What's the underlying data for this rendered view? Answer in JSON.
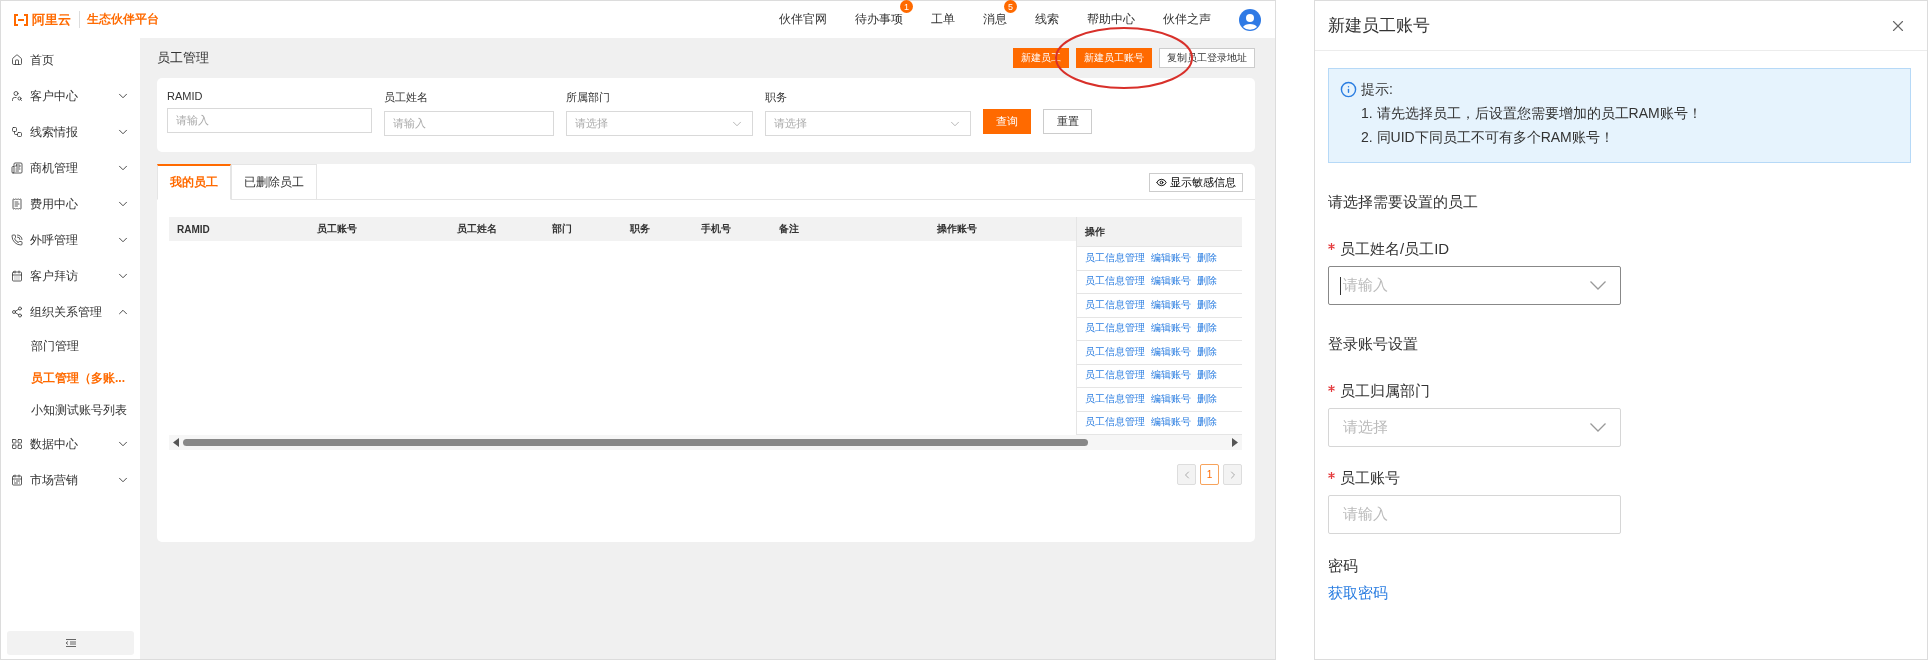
{
  "header": {
    "logo": "阿里云",
    "platform": "生态伙伴平台",
    "nav": [
      {
        "label": "伙伴官网"
      },
      {
        "label": "待办事项",
        "badge": "1"
      },
      {
        "label": "工单"
      },
      {
        "label": "消息",
        "badge": "5"
      },
      {
        "label": "线索"
      },
      {
        "label": "帮助中心"
      },
      {
        "label": "伙伴之声"
      }
    ]
  },
  "sidebar": {
    "items": [
      {
        "label": "首页"
      },
      {
        "label": "客户中心",
        "expanded": false
      },
      {
        "label": "线索情报",
        "expanded": false
      },
      {
        "label": "商机管理",
        "expanded": false
      },
      {
        "label": "费用中心",
        "expanded": false
      },
      {
        "label": "外呼管理",
        "expanded": false
      },
      {
        "label": "客户拜访",
        "expanded": false
      },
      {
        "label": "组织关系管理",
        "expanded": true,
        "children": [
          {
            "label": "部门管理",
            "selected": false
          },
          {
            "label": "员工管理（多账...",
            "selected": true
          },
          {
            "label": "小知测试账号列表",
            "selected": false
          }
        ]
      },
      {
        "label": "数据中心",
        "expanded": false
      },
      {
        "label": "市场营销",
        "expanded": false
      }
    ]
  },
  "page": {
    "title": "员工管理",
    "actions": [
      {
        "label": "新建员工",
        "kind": "primary"
      },
      {
        "label": "新建员工账号",
        "kind": "primary"
      },
      {
        "label": "复制员工登录地址",
        "kind": "default"
      }
    ],
    "filters": [
      {
        "label": "RAMID",
        "placeholder": "请输入",
        "kind": "input"
      },
      {
        "label": "员工姓名",
        "placeholder": "请输入",
        "kind": "input"
      },
      {
        "label": "所属部门",
        "placeholder": "请选择",
        "kind": "select"
      },
      {
        "label": "职务",
        "placeholder": "请选择",
        "kind": "select"
      }
    ],
    "filter_buttons": [
      {
        "label": "查询",
        "kind": "primary"
      },
      {
        "label": "重置",
        "kind": "default"
      }
    ],
    "tabs": [
      {
        "label": "我的员工",
        "selected": true
      },
      {
        "label": "已删除员工",
        "selected": false
      }
    ],
    "sensitive_button": "显示敏感信息",
    "table": {
      "columns": [
        "RAMID",
        "员工账号",
        "员工姓名",
        "部门",
        "职务",
        "手机号",
        "备注",
        "操作账号"
      ],
      "fixed_column": "操作",
      "rows": [
        {
          "actions": [
            "员工信息管理",
            "编辑账号",
            "删除"
          ]
        },
        {
          "actions": [
            "员工信息管理",
            "编辑账号",
            "删除"
          ]
        },
        {
          "actions": [
            "员工信息管理",
            "编辑账号",
            "删除"
          ]
        },
        {
          "actions": [
            "员工信息管理",
            "编辑账号",
            "删除"
          ]
        },
        {
          "actions": [
            "员工信息管理",
            "编辑账号",
            "删除"
          ]
        },
        {
          "actions": [
            "员工信息管理",
            "编辑账号",
            "删除"
          ]
        },
        {
          "actions": [
            "员工信息管理",
            "编辑账号",
            "删除"
          ]
        },
        {
          "actions": [
            "员工信息管理",
            "编辑账号",
            "删除"
          ]
        }
      ]
    },
    "pagination": [
      {
        "label": "1",
        "selected": true
      }
    ]
  },
  "dialog": {
    "title": "新建员工账号",
    "alert": {
      "title": "提示:",
      "lines": [
        "1. 请先选择员工，后设置您需要增加的员工RAM账号！",
        "2. 同UID下同员工不可有多个RAM账号！"
      ]
    },
    "items": [
      {
        "kind": "heading",
        "text": "请选择需要设置的员工"
      },
      {
        "kind": "field",
        "label": "员工姓名/员工ID",
        "required": true,
        "placeholder": "请输入",
        "select": true,
        "focused": true
      },
      {
        "kind": "heading",
        "text": "登录账号设置"
      },
      {
        "kind": "field",
        "label": "员工归属部门",
        "required": true,
        "placeholder": "请选择",
        "select": true,
        "focused": false
      },
      {
        "kind": "field",
        "label": "员工账号",
        "required": true,
        "placeholder": "请输入",
        "select": false,
        "focused": false
      },
      {
        "kind": "label",
        "text": "密码"
      },
      {
        "kind": "link",
        "text": "获取密码"
      }
    ]
  }
}
